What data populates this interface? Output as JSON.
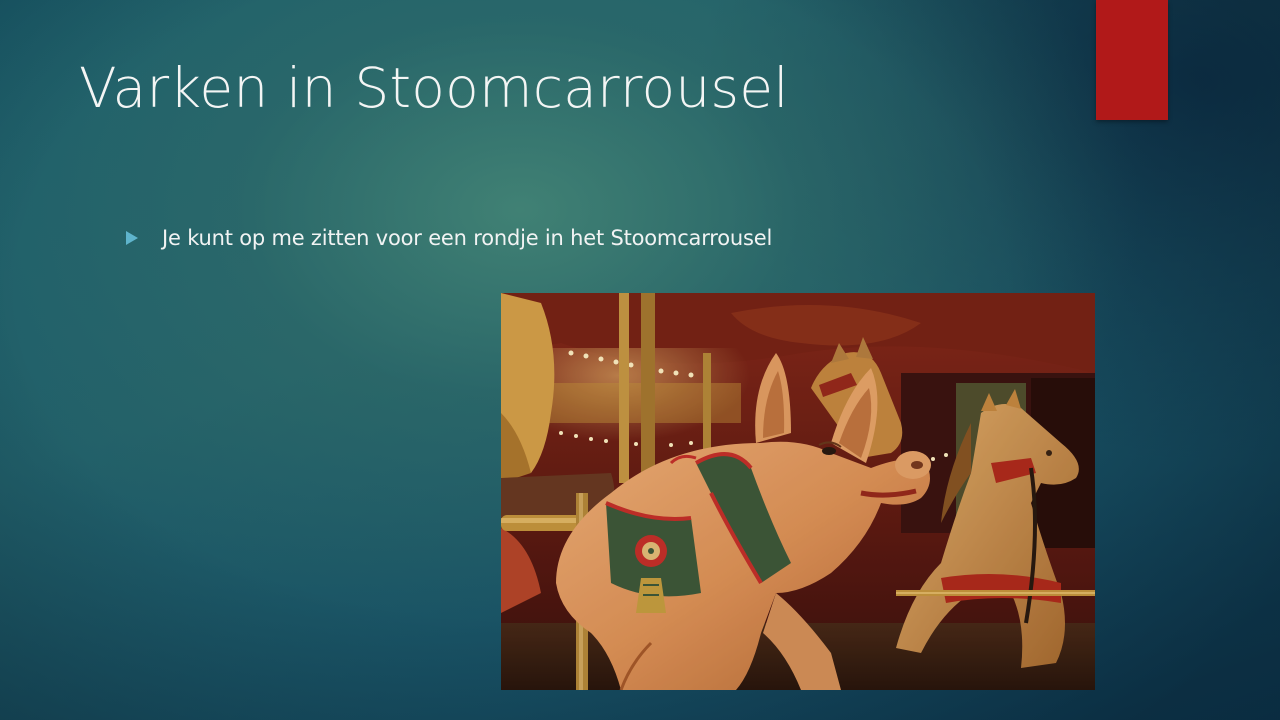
{
  "slide": {
    "title": "Varken in Stoomcarrousel",
    "bullets": [
      {
        "text": "Je kunt op me zitten voor een rondje in het Stoomcarrousel"
      }
    ],
    "image": {
      "alt": "Houten varken in een stoomcarrousel",
      "subject": "carousel-pig-photo"
    },
    "colors": {
      "background": "#1d5a66",
      "accent_bar": "#b11919",
      "bullet_marker": "#5fb4cc",
      "text": "#f3f5f4"
    }
  }
}
